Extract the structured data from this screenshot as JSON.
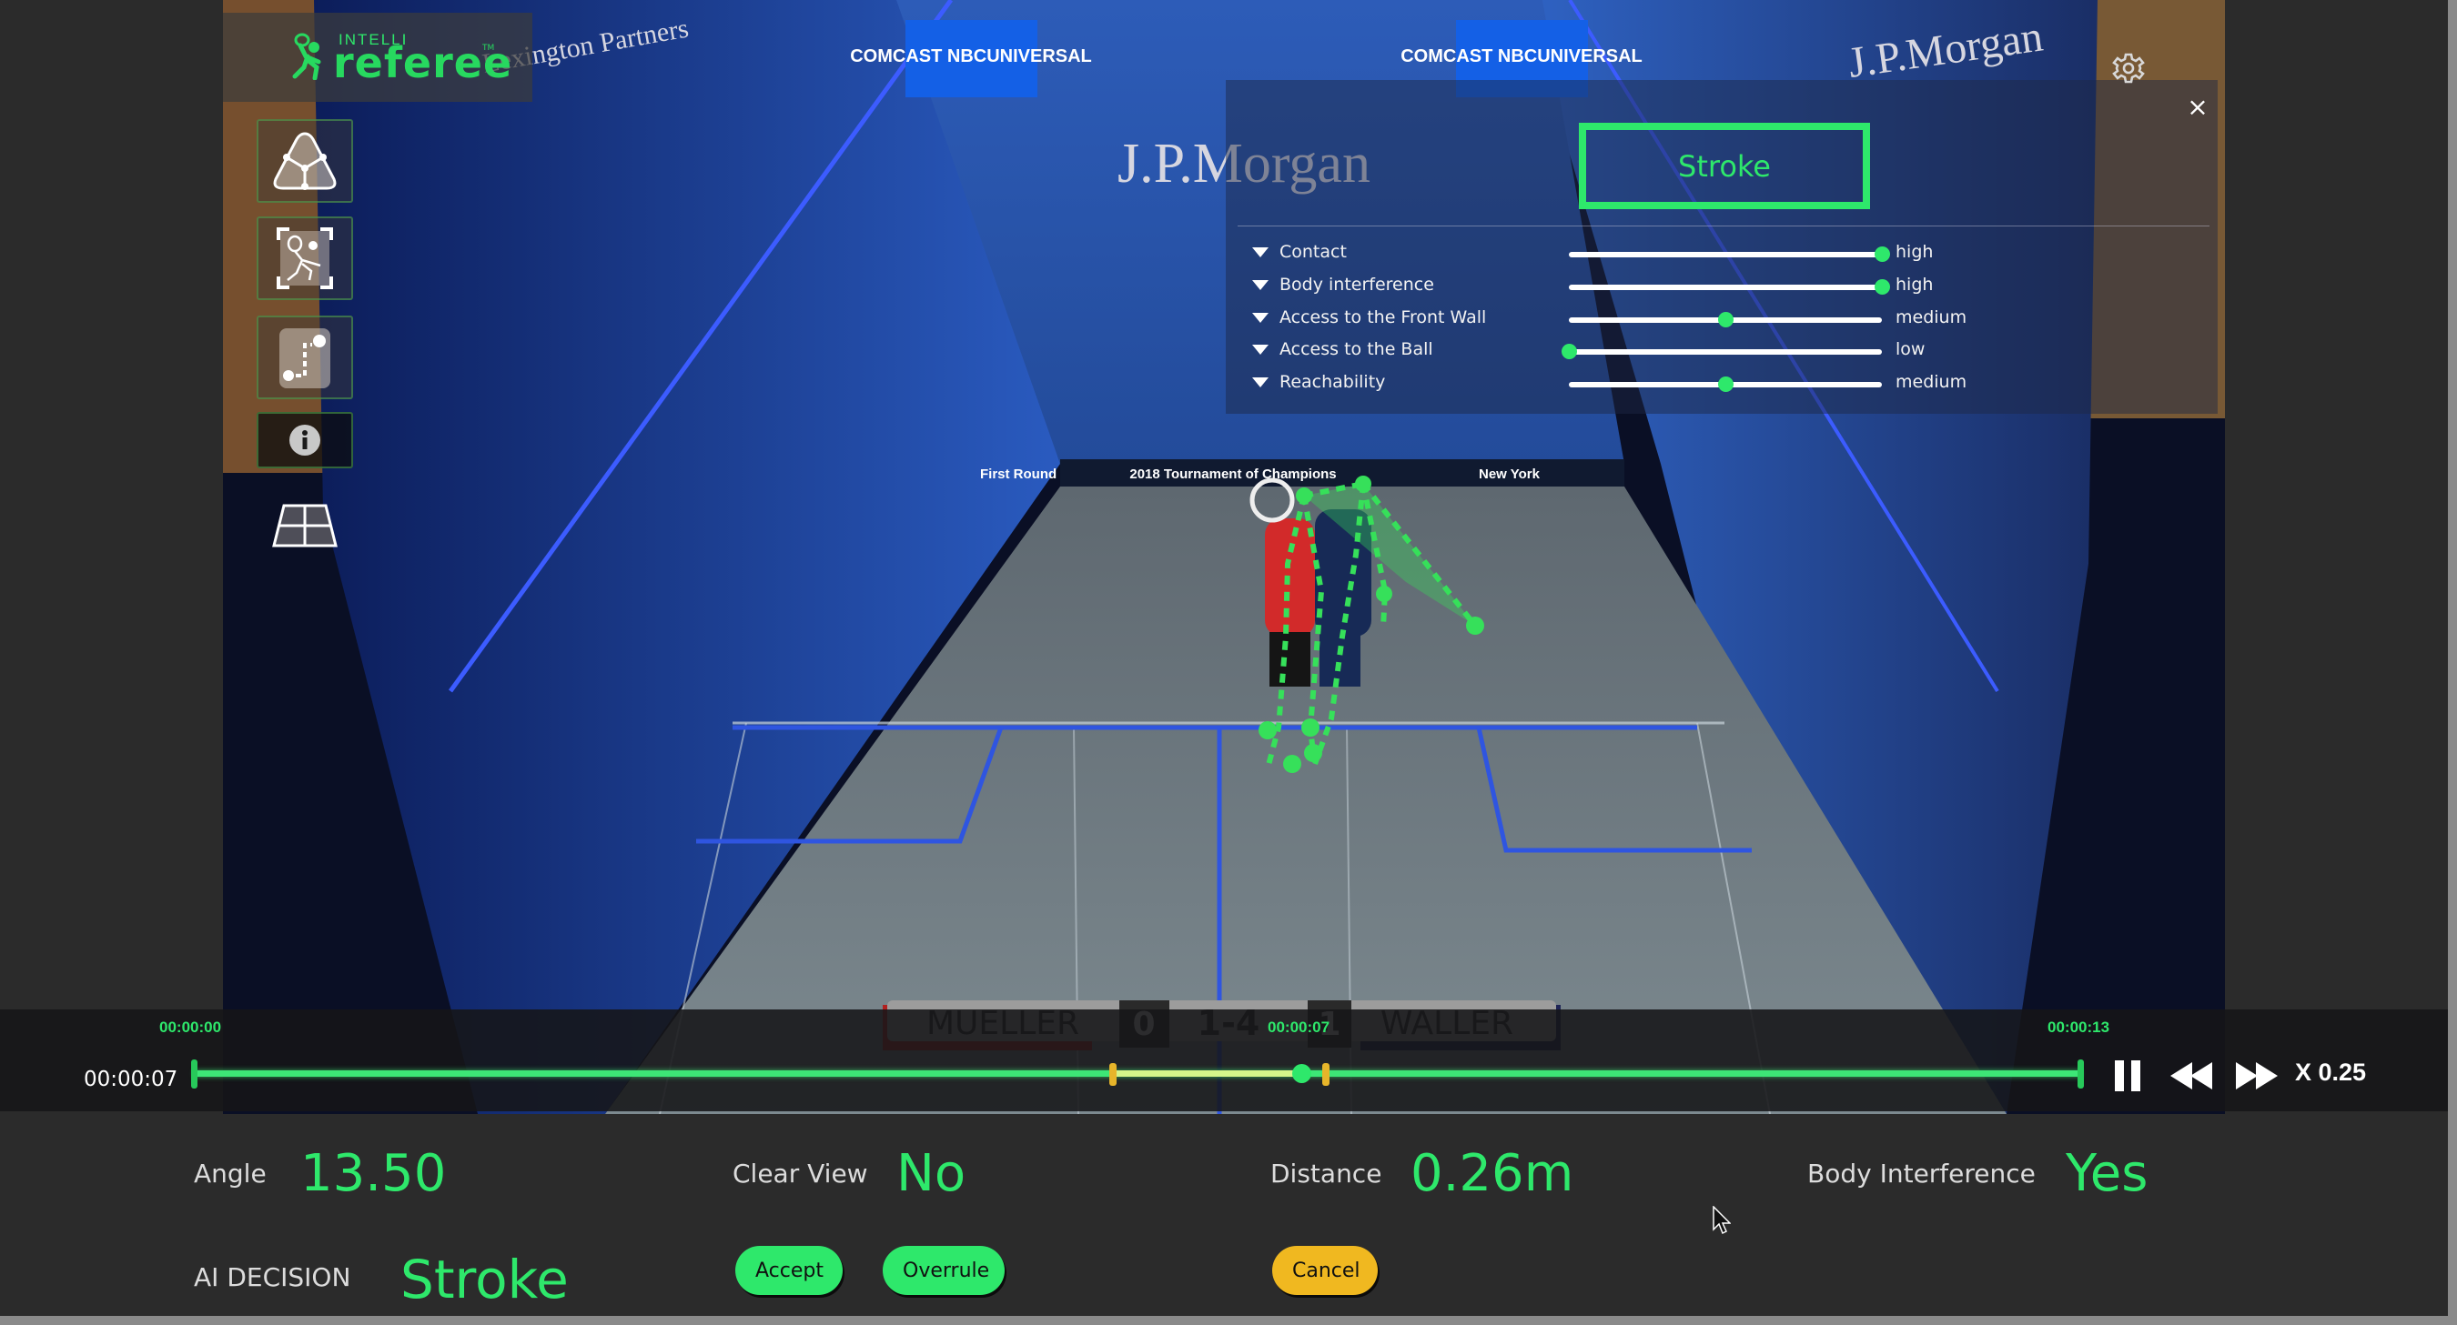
{
  "app": {
    "logo_small": "INTELLI",
    "logo_main": "referee",
    "logo_tm": "TM"
  },
  "sidebar": {
    "tools": [
      {
        "name": "triangulation-tool",
        "icon": "triangle-nodes-icon"
      },
      {
        "name": "player-detection-tool",
        "icon": "player-focus-icon"
      },
      {
        "name": "trajectory-tool",
        "icon": "trajectory-icon"
      },
      {
        "name": "info-tool",
        "icon": "info-icon"
      },
      {
        "name": "court-view-tool",
        "icon": "court-grid-icon"
      }
    ]
  },
  "video_scene": {
    "sponsor_banners": [
      "COMCAST NBCUNIVERSAL",
      "COMCAST NBCUNIVERSAL",
      "J.P.Morgan",
      "J.P.Morgan",
      "Lexington Partners"
    ],
    "tin_banner": [
      "First Round",
      "2018 Tournament of Champions",
      "New York"
    ],
    "scoreboard": {
      "player_left": "MUELLER",
      "games_left": "0",
      "points": "1-4",
      "games_right": "1",
      "player_right": "WALLER"
    }
  },
  "decision_panel": {
    "decision": "Stroke",
    "close_label": "×",
    "criteria": [
      {
        "label": "Contact",
        "value": "high",
        "level": 1.0
      },
      {
        "label": "Body interference",
        "value": "high",
        "level": 1.0
      },
      {
        "label": "Access to the Front Wall",
        "value": "medium",
        "level": 0.5
      },
      {
        "label": "Access to the Ball",
        "value": "low",
        "level": 0.0
      },
      {
        "label": "Reachability",
        "value": "medium",
        "level": 0.5
      }
    ]
  },
  "playback": {
    "start_time": "00:00:00",
    "current_time": "00:00:07",
    "end_time": "00:00:13",
    "current_time_display": "00:00:07",
    "progress": 0.587,
    "marker_in": 0.487,
    "marker_out": 0.6,
    "speed_label": "X 0.25"
  },
  "metrics": {
    "angle_label": "Angle",
    "angle_value": "13.50",
    "clear_view_label": "Clear View",
    "clear_view_value": "No",
    "distance_label": "Distance",
    "distance_value": "0.26m",
    "body_interference_label": "Body Interference",
    "body_interference_value": "Yes",
    "ai_decision_label": "AI DECISION",
    "ai_decision_value": "Stroke"
  },
  "actions": {
    "accept": "Accept",
    "overrule": "Overrule",
    "cancel": "Cancel"
  },
  "colors": {
    "accent_green": "#2ee86b",
    "cancel_yellow": "#f0b820",
    "marker_yellow": "#e7b52a",
    "background": "#2b2b2b"
  }
}
